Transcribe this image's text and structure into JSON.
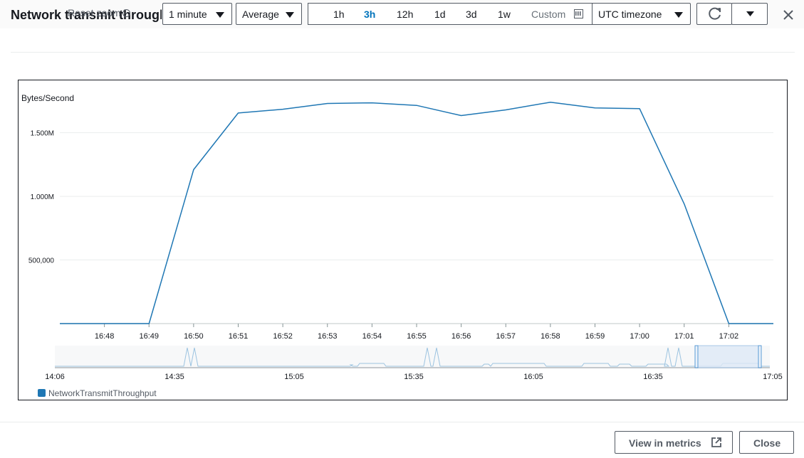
{
  "header": {
    "title": "Network transmit throughput",
    "reset_zoom": "Reset zoom",
    "period": "1 minute",
    "statistic": "Average",
    "ranges": [
      "1h",
      "3h",
      "12h",
      "1d",
      "3d",
      "1w"
    ],
    "active_range": "3h",
    "custom": "Custom",
    "timezone": "UTC timezone"
  },
  "footer": {
    "view_in_metrics": "View in metrics",
    "close": "Close"
  },
  "colors": {
    "series": "#1f77b4",
    "active_range": "#0073bb"
  },
  "chart_data": {
    "type": "line",
    "ylabel": "Bytes/Second",
    "ytick_labels": [
      "500,000",
      "1.000M",
      "1.500M"
    ],
    "yticks": [
      500000,
      1000000,
      1500000
    ],
    "ylim": [
      0,
      1800000
    ],
    "x": [
      "16:47",
      "16:48",
      "16:49",
      "16:50",
      "16:51",
      "16:52",
      "16:53",
      "16:54",
      "16:55",
      "16:56",
      "16:57",
      "16:58",
      "16:59",
      "17:00",
      "17:01",
      "17:02",
      "17:03"
    ],
    "xtick_labels": [
      "16:48",
      "16:49",
      "16:50",
      "16:51",
      "16:52",
      "16:53",
      "16:54",
      "16:55",
      "16:56",
      "16:57",
      "16:58",
      "16:59",
      "17:00",
      "17:01",
      "17:02"
    ],
    "series": [
      {
        "name": "NetworkTransmitThroughput",
        "values": [
          0,
          0,
          0,
          1210000,
          1655000,
          1685000,
          1730000,
          1735000,
          1715000,
          1635000,
          1680000,
          1740000,
          1695000,
          1690000,
          940000,
          0,
          0
        ]
      }
    ],
    "grid": true,
    "legend": "bottom-left",
    "overview": {
      "tick_labels": [
        "14:06",
        "14:35",
        "15:05",
        "15:35",
        "16:05",
        "16:35",
        "17:05"
      ]
    }
  }
}
